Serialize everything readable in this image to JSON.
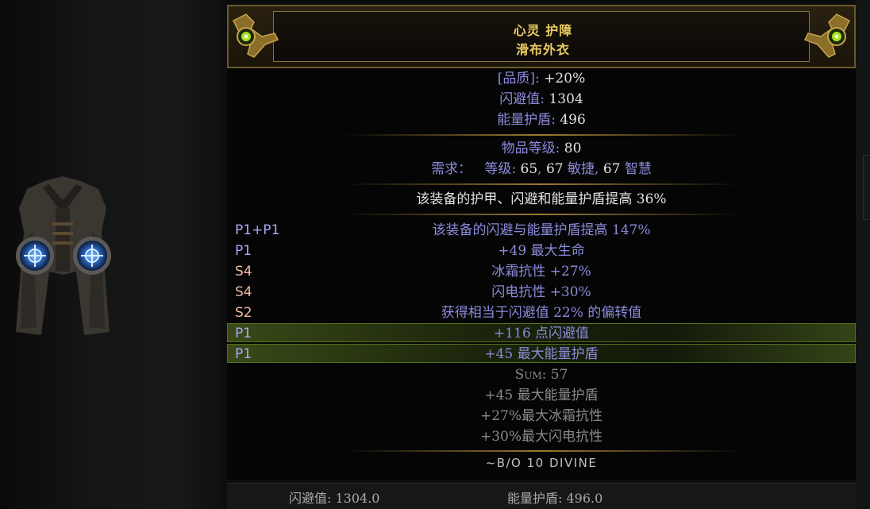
{
  "item": {
    "name": "心灵 护障",
    "base_type": "滑布外衣",
    "quality_label": "[品质]:",
    "quality_value": "+20%",
    "evasion_label": "闪避值:",
    "evasion_value": "1304",
    "es_label": "能量护盾:",
    "es_value": "496",
    "item_level_label": "物品等级:",
    "item_level_value": "80",
    "req_label": "需求：",
    "req_text_a": "等级:",
    "req_level": "65",
    "req_dex_num": "67",
    "req_dex_label": "敏捷",
    "req_int_num": "67",
    "req_int_label": "智慧",
    "implicit": "该装备的护甲、闪避和能量护盾提高 36%"
  },
  "mods": [
    {
      "tag": "P1+P1",
      "tag_type": "prefix",
      "text": "该装备的闪避与能量护盾提高 147%",
      "highlighted": false
    },
    {
      "tag": "P1",
      "tag_type": "prefix",
      "text": "+49 最大生命",
      "highlighted": false
    },
    {
      "tag": "S4",
      "tag_type": "suffix",
      "text": "冰霜抗性 +27%",
      "highlighted": false
    },
    {
      "tag": "S4",
      "tag_type": "suffix",
      "text": "闪电抗性 +30%",
      "highlighted": false
    },
    {
      "tag": "S2",
      "tag_type": "suffix",
      "text": "获得相当于闪避值 22% 的偏转值",
      "highlighted": false
    },
    {
      "tag": "P1",
      "tag_type": "prefix",
      "text": "+116 点闪避值",
      "highlighted": true
    },
    {
      "tag": "P1",
      "tag_type": "prefix",
      "text": "+45 最大能量护盾",
      "highlighted": true
    }
  ],
  "summary": {
    "sum": "Sum: 57",
    "lines": [
      "+45 最大能量护盾",
      "+27%最大冰霜抗性",
      "+30%最大闪电抗性"
    ]
  },
  "price_note": "~B/O 10 DIVINE",
  "bottom": {
    "evasion": "闪避值: 1304.0",
    "es": "能量护盾: 496.0"
  },
  "colors": {
    "title": "#e9cc62",
    "magic_text": "#8b8bdc",
    "value_white": "#e1e1e1",
    "prefix_tag": "#a8a8ff",
    "suffix_tag": "#f0b8a0",
    "highlight": "#58721c"
  },
  "icons": {
    "item": "body-armour-icon",
    "ornament": "gold-ornament-icon"
  }
}
